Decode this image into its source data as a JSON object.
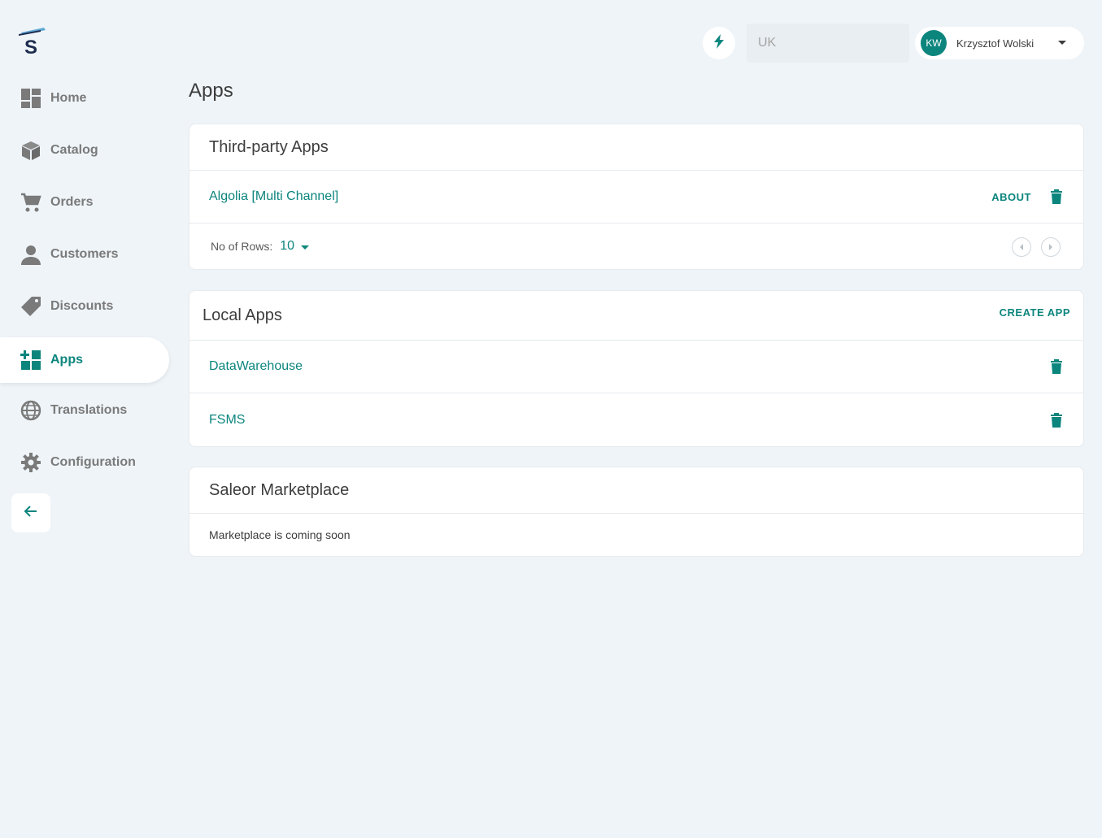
{
  "sidebar": {
    "items": [
      {
        "label": "Home",
        "icon": "dashboard-icon"
      },
      {
        "label": "Catalog",
        "icon": "box-icon"
      },
      {
        "label": "Orders",
        "icon": "cart-icon"
      },
      {
        "label": "Customers",
        "icon": "person-icon"
      },
      {
        "label": "Discounts",
        "icon": "tag-icon"
      },
      {
        "label": "Apps",
        "icon": "apps-icon",
        "active": true
      },
      {
        "label": "Translations",
        "icon": "globe-icon"
      },
      {
        "label": "Configuration",
        "icon": "gear-icon"
      }
    ]
  },
  "header": {
    "channel_placeholder": "UK",
    "user": {
      "initials": "KW",
      "name": "Krzysztof Wolski"
    }
  },
  "page": {
    "title": "Apps"
  },
  "third_party": {
    "title": "Third-party Apps",
    "apps": [
      {
        "name": "Algolia [Multi Channel]",
        "about_label": "ABOUT"
      }
    ],
    "rows_label": "No of Rows:",
    "rows_value": "10"
  },
  "local": {
    "title": "Local Apps",
    "create_label": "CREATE APP",
    "apps": [
      {
        "name": "DataWarehouse"
      },
      {
        "name": "FSMS"
      }
    ]
  },
  "marketplace": {
    "title": "Saleor Marketplace",
    "message": "Marketplace is coming soon"
  },
  "colors": {
    "accent": "#0c857d",
    "background": "#eff4f8",
    "muted": "#7a7a7a"
  }
}
